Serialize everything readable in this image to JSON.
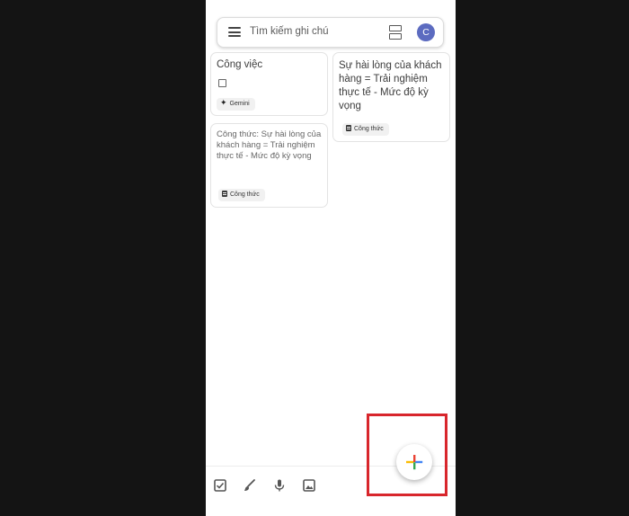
{
  "search": {
    "placeholder": "Tìm kiếm ghi chú"
  },
  "account": {
    "avatar_letter": "C",
    "avatar_color": "#5c6bc0"
  },
  "notes": [
    {
      "title": "Công việc",
      "checklist_items": [
        ""
      ],
      "chip": {
        "label": "Gemini",
        "icon": "sparkle-icon"
      }
    },
    {
      "title": "",
      "body": "Công thức: Sự hài lòng của khách hàng = Trải nghiệm thực tế  - Mức độ kỳ vọng",
      "chip": {
        "label": "Công thức",
        "icon": "document-icon"
      }
    },
    {
      "title": "Sự hài lòng của khách hàng = Trải nghiệm thực tế - Mức độ kỳ vọng",
      "chip": {
        "label": "Công thức",
        "icon": "document-icon"
      }
    }
  ],
  "bottom_bar": {
    "icons": [
      "checkbox-icon",
      "brush-icon",
      "microphone-icon",
      "image-icon"
    ]
  },
  "fab": {
    "icon": "plus-icon",
    "colors": [
      "#ea4335",
      "#4285f4",
      "#fbbc05",
      "#34a853"
    ]
  },
  "highlight": {
    "color": "#d8262c"
  }
}
